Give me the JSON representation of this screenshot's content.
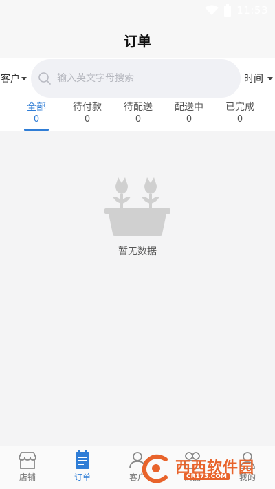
{
  "status_bar": {
    "time": "11:53"
  },
  "header": {
    "title": "订单"
  },
  "filters": {
    "customer_label": "客户",
    "search_placeholder": "输入英文字母搜索",
    "time_label": "时间"
  },
  "tabs": [
    {
      "label": "全部",
      "count": "0",
      "active": true
    },
    {
      "label": "待付款",
      "count": "0"
    },
    {
      "label": "待配送",
      "count": "0"
    },
    {
      "label": "配送中",
      "count": "0"
    },
    {
      "label": "已完成",
      "count": "0"
    }
  ],
  "empty_state": {
    "text": "暂无数据"
  },
  "bottom_nav": [
    {
      "label": "店铺",
      "icon": "store-icon"
    },
    {
      "label": "订单",
      "icon": "order-icon",
      "active": true
    },
    {
      "label": "客户",
      "icon": "customer-icon"
    },
    {
      "label": "商品",
      "icon": "product-icon"
    },
    {
      "label": "我的",
      "icon": "profile-icon"
    }
  ],
  "watermark": {
    "brand": "西西软件园",
    "domain": "CR173.COM"
  },
  "colors": {
    "accent": "#2f7dd6",
    "background": "#f4f4f5",
    "watermark": "#e8632b"
  }
}
